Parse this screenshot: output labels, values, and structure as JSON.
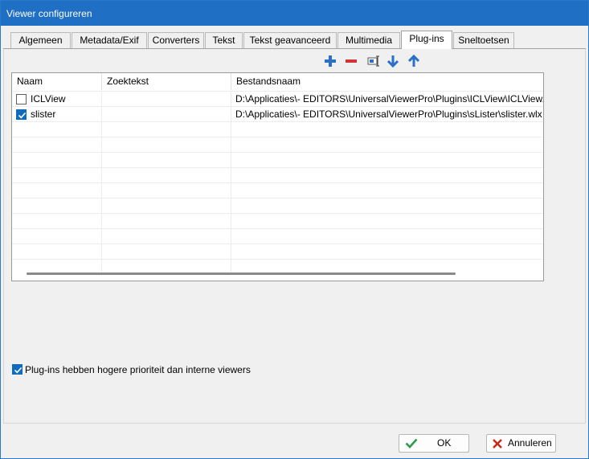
{
  "window": {
    "title": "Viewer configureren"
  },
  "tabs": [
    {
      "label": "Algemeen",
      "active": false
    },
    {
      "label": "Metadata/Exif",
      "active": false
    },
    {
      "label": "Converters",
      "active": false
    },
    {
      "label": "Tekst",
      "active": false
    },
    {
      "label": "Tekst geavanceerd",
      "active": false
    },
    {
      "label": "Multimedia",
      "active": false
    },
    {
      "label": "Plug-ins",
      "active": true
    },
    {
      "label": "Sneltoetsen",
      "active": false
    }
  ],
  "toolbar": {
    "icons": [
      "add-icon",
      "remove-icon",
      "edit-icon",
      "move-down-icon",
      "move-up-icon"
    ],
    "colors": {
      "add": "#2a6fc8",
      "remove": "#d13438",
      "arrow": "#2a6fc8"
    }
  },
  "plugins_table": {
    "columns": [
      "Naam",
      "Zoektekst",
      "Bestandsnaam"
    ],
    "rows": [
      {
        "checked": false,
        "name": "ICLView",
        "search": "",
        "file": "D:\\Applicaties\\- EDITORS\\UniversalViewerPro\\Plugins\\ICLView\\ICLView.wlx"
      },
      {
        "checked": true,
        "name": "slister",
        "search": "",
        "file": "D:\\Applicaties\\- EDITORS\\UniversalViewerPro\\Plugins\\sLister\\slister.wlx"
      }
    ]
  },
  "options": {
    "priority_checked": true,
    "priority_label": "Plug-ins hebben hogere prioriteit dan interne viewers"
  },
  "buttons": {
    "ok_label": "OK",
    "cancel_label": "Annuleren"
  },
  "colors": {
    "titlebar": "#1f6fc4",
    "accent": "#0f6cbd",
    "ok_check": "#2e9b4a",
    "cancel_x": "#c42b1c"
  }
}
